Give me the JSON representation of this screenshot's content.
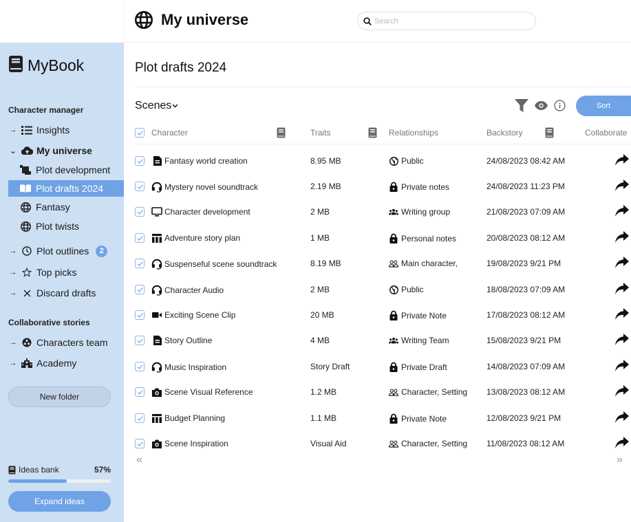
{
  "app": {
    "brand": "MyBook",
    "header_title": "My universe",
    "search_placeholder": "Search"
  },
  "sidebar": {
    "sections": [
      {
        "title": "Character manager"
      },
      {
        "title": "Collaborative stories"
      }
    ],
    "items": [
      {
        "label": "Insights",
        "icon": "list-icon",
        "arrow": "right"
      },
      {
        "label": "My universe",
        "icon": "cloud-upload-icon",
        "arrow": "down"
      },
      {
        "label": "Plot development",
        "icon": "scroll-icon"
      },
      {
        "label": "Plot drafts 2024",
        "icon": "open-book-icon",
        "active": true
      },
      {
        "label": "Fantasy",
        "icon": "globe-icon"
      },
      {
        "label": "Plot twists",
        "icon": "globe-icon"
      },
      {
        "label": "Plot outlines",
        "icon": "clock-icon",
        "arrow": "right",
        "badge": "2"
      },
      {
        "label": "Top picks",
        "icon": "star-icon",
        "arrow": "right"
      },
      {
        "label": "Discard drafts",
        "icon": "close-icon",
        "arrow": "right"
      },
      {
        "label": "Characters team",
        "icon": "team-icon",
        "arrow": "right"
      },
      {
        "label": "Academy",
        "icon": "school-icon",
        "arrow": "right"
      }
    ],
    "new_folder": "New folder",
    "ideas_bank": {
      "label": "Ideas bank",
      "percent_label": "57%",
      "percent": 57
    },
    "expand_ideas": "Expand ideas"
  },
  "main": {
    "page_title": "Plot drafts 2024",
    "view_selector": "Scenes",
    "sort_label": "Sort",
    "columns": [
      "Character",
      "Traits",
      "Relationships",
      "Backstory",
      "Collaborate"
    ],
    "rows": [
      {
        "icon": "document-icon",
        "name": "Fantasy world creation",
        "traits": "8.95 MB",
        "rel_icon": "globe-icon",
        "rel": "Public",
        "backstory": "24/08/2023 08:42 AM"
      },
      {
        "icon": "headphones-icon",
        "name": "Mystery novel soundtrack",
        "traits": "2.19 MB",
        "rel_icon": "lock-icon",
        "rel": "Private notes",
        "backstory": "24/08/2023 11:23 PM"
      },
      {
        "icon": "monitor-icon",
        "name": "Character development",
        "traits": "2 MB",
        "rel_icon": "group-icon",
        "rel": "Writing group",
        "backstory": "21/08/2023 07:09 AM"
      },
      {
        "icon": "table-icon",
        "name": "Adventure story plan",
        "traits": "1 MB",
        "rel_icon": "lock-icon",
        "rel": "Personal notes",
        "backstory": "20/08/2023 08:12 AM"
      },
      {
        "icon": "headphones-icon",
        "name": "Suspenseful scene soundtrack",
        "traits": "8.19 MB",
        "rel_icon": "people-outline-icon",
        "rel": "Main character,",
        "backstory": "19/08/2023 9/21 PM"
      },
      {
        "icon": "headphones-icon",
        "name": "Character Audio",
        "traits": "2 MB",
        "rel_icon": "globe-icon",
        "rel": "Public",
        "backstory": "18/08/2023 07:09 AM"
      },
      {
        "icon": "video-icon",
        "name": "Exciting Scene Clip",
        "traits": "20 MB",
        "rel_icon": "lock-icon",
        "rel": "Private Note",
        "backstory": "17/08/2023 08:12 AM"
      },
      {
        "icon": "document-icon",
        "name": "Story Outline",
        "traits": "4 MB",
        "rel_icon": "group-icon",
        "rel": "Writing Team",
        "backstory": "15/08/2023 9/21 PM"
      },
      {
        "icon": "headphones-icon",
        "name": "Music Inspiration",
        "traits": "Story Draft",
        "rel_icon": "lock-icon",
        "rel": "Private Draft",
        "backstory": "14/08/2023 07:09 AM"
      },
      {
        "icon": "camera-icon",
        "name": "Scene Visual Reference",
        "traits": "1.2 MB",
        "rel_icon": "people-outline-icon",
        "rel": "Character, Setting",
        "backstory": "13/08/2023 08:12 AM"
      },
      {
        "icon": "table-icon",
        "name": "Budget Planning",
        "traits": "1.1 MB",
        "rel_icon": "lock-icon",
        "rel": "Private Note",
        "backstory": "12/08/2023 9/21 PM"
      },
      {
        "icon": "camera-icon",
        "name": "Scene Inspiration",
        "traits": "Visual Aid",
        "rel_icon": "people-outline-icon",
        "rel": "Character, Setting",
        "backstory": "11/08/2023 08:12 AM"
      }
    ],
    "pager_prev": "«",
    "pager_next": "»"
  },
  "colors": {
    "accent": "#6fa3e6",
    "sidebar_bg": "#cddff3"
  }
}
